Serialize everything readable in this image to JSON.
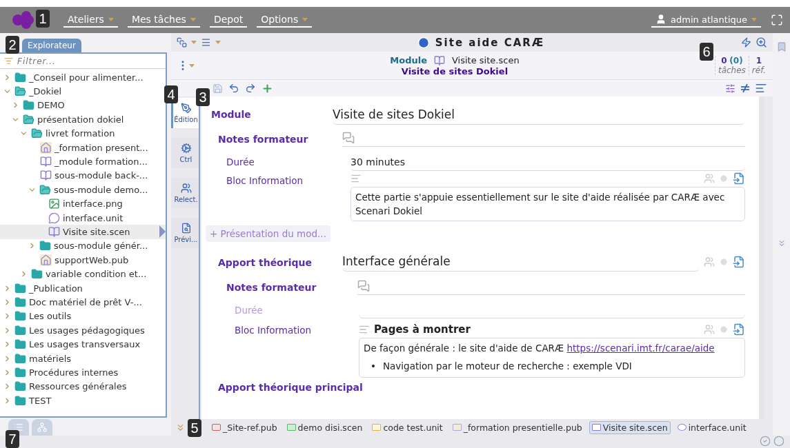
{
  "topbar": {
    "menus": [
      {
        "label": "Ateliers",
        "dropdown": true
      },
      {
        "label": "Mes tâches",
        "dropdown": true
      },
      {
        "label": "Depot",
        "dropdown": false
      },
      {
        "label": "Options",
        "dropdown": true
      }
    ],
    "user": "admin atlantique"
  },
  "explorer": {
    "tab": "Explorateur",
    "filter_placeholder": "Filtrer...",
    "tree": [
      {
        "label": "_Conseil pour alimenter...",
        "kind": "folder",
        "expanded": false
      },
      {
        "label": "_Dokiel",
        "kind": "folder",
        "expanded": true,
        "children": [
          {
            "label": "DEMO",
            "kind": "folder",
            "expanded": false
          },
          {
            "label": "présentation dokiel",
            "kind": "folder",
            "expanded": true,
            "children": [
              {
                "label": "livret formation",
                "kind": "folder",
                "expanded": true,
                "children": [
                  {
                    "label": "_formation present...",
                    "kind": "pub"
                  },
                  {
                    "label": "_module formation...",
                    "kind": "scen"
                  },
                  {
                    "label": "sous-module back-...",
                    "kind": "scen"
                  },
                  {
                    "label": "sous-module demo...",
                    "kind": "folder",
                    "expanded": true,
                    "children": [
                      {
                        "label": "interface.png",
                        "kind": "image",
                        "selected": false
                      },
                      {
                        "label": "interface.unit",
                        "kind": "unit",
                        "selected": false
                      },
                      {
                        "label": "Visite site.scen",
                        "kind": "scen",
                        "selected": true
                      }
                    ]
                  },
                  {
                    "label": "sous-module génér...",
                    "kind": "folder",
                    "expanded": false
                  },
                  {
                    "label": "supportWeb.pub",
                    "kind": "pub"
                  }
                ]
              },
              {
                "label": "variable condition et...",
                "kind": "folder",
                "expanded": false
              }
            ]
          }
        ]
      },
      {
        "label": "_Publication",
        "kind": "folder",
        "expanded": false
      },
      {
        "label": "Doc matériel de prêt V-...",
        "kind": "folder",
        "expanded": false
      },
      {
        "label": "Les outils",
        "kind": "folder",
        "expanded": false
      },
      {
        "label": "Les usages pédagogiques",
        "kind": "folder",
        "expanded": false
      },
      {
        "label": "Les usages transversaux",
        "kind": "folder",
        "expanded": false
      },
      {
        "label": "matériels",
        "kind": "folder",
        "expanded": false
      },
      {
        "label": "Procédures internes",
        "kind": "folder",
        "expanded": false
      },
      {
        "label": "Ressources générales",
        "kind": "folder",
        "expanded": false
      },
      {
        "label": "TEST",
        "kind": "folder",
        "expanded": false
      }
    ]
  },
  "header": {
    "title": "Site aide CARÆ",
    "item_type": "Module",
    "file": "Visite site.scen",
    "item_title": "Visite de sites Dokiel",
    "tasks": {
      "count": "0",
      "pending": "(0)",
      "label": "tâches"
    },
    "refs": {
      "count": "1",
      "label": "réf."
    }
  },
  "side_tabs": [
    {
      "label": "Édition",
      "kind": "edit",
      "selected": true
    },
    {
      "label": "Ctrl",
      "kind": "ctrl",
      "selected": false
    },
    {
      "label": "Relect.",
      "kind": "review",
      "selected": false
    },
    {
      "label": "Prévi...",
      "kind": "preview",
      "selected": false
    }
  ],
  "editor": {
    "module_label": "Module",
    "module_title": "Visite de sites Dokiel",
    "notes": {
      "label": "Notes formateur",
      "duration_label": "Durée",
      "duration": "30 minutes",
      "info_label": "Bloc Information",
      "info_text": "Cette partie s'appuie essentiellement sur le site d'aide réalisée par CARÆ avec Scenari Dokiel"
    },
    "add_button": "+ Présentation du mod...",
    "section": {
      "label": "Apport théorique",
      "value": "Interface générale",
      "notes": {
        "label": "Notes formateur",
        "duration_label": "Durée",
        "info_label": "Bloc Information",
        "info_title": "Pages à montrer",
        "info_text": "De façon générale : le site d'aide de CARÆ",
        "link": "https://scenari.imt.fr/carae/aide",
        "bullet_mark": "•",
        "bullet": "Navigation par le moteur de recherche : exemple VDI"
      }
    },
    "next_label": "Apport théorique principal"
  },
  "doc_tabs": [
    {
      "label": "_Site-ref.pub",
      "kind": "ref",
      "selected": false
    },
    {
      "label": "demo disi.scen",
      "kind": "green",
      "selected": false
    },
    {
      "label": "code test.unit",
      "kind": "yellow",
      "selected": false
    },
    {
      "label": "_formation presentielle.pub",
      "kind": "pub",
      "selected": false
    },
    {
      "label": "Visite site.scen",
      "kind": "scen",
      "selected": true
    },
    {
      "label": "interface.unit",
      "kind": "unit",
      "selected": false
    }
  ],
  "callouts": [
    "1",
    "2",
    "3",
    "4",
    "5",
    "6",
    "7"
  ]
}
